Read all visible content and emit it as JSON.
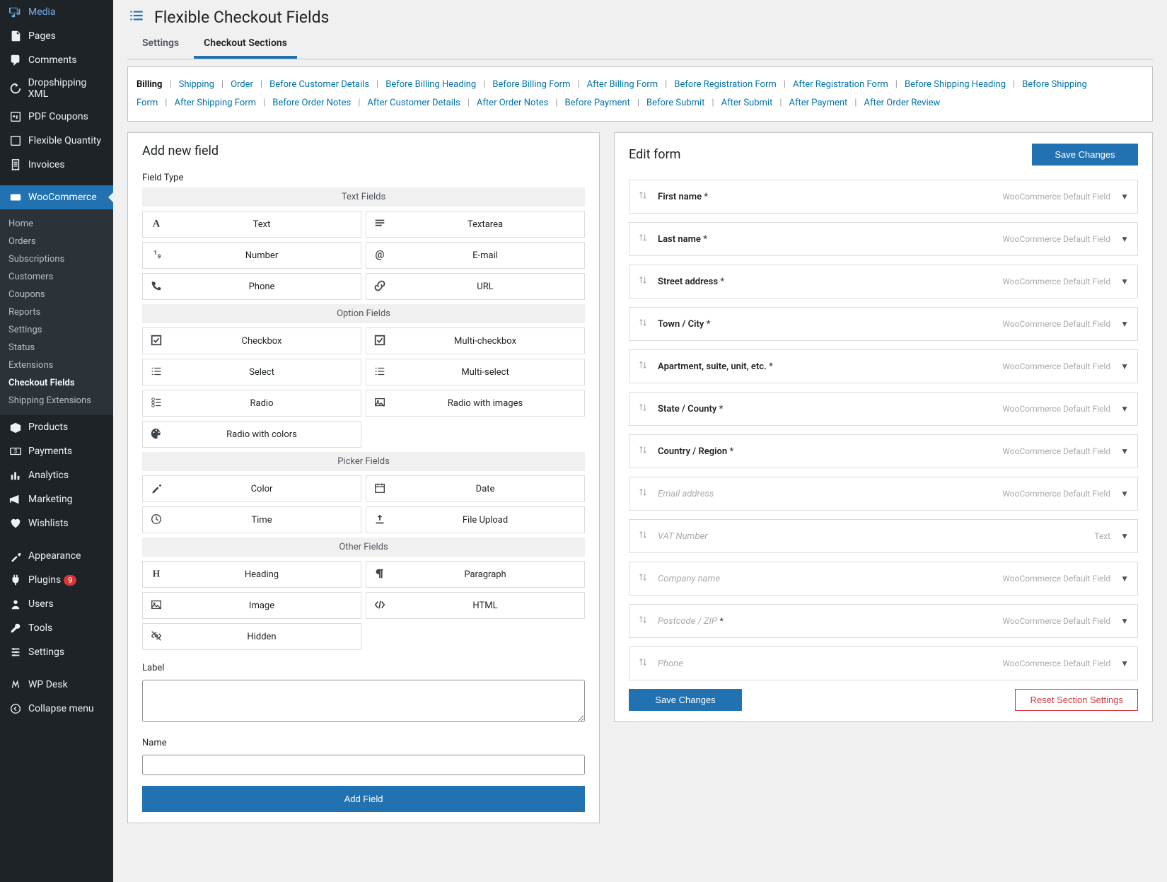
{
  "page_title": "Flexible Checkout Fields",
  "sidebar": {
    "items": [
      {
        "label": "Media",
        "icon": "media"
      },
      {
        "label": "Pages",
        "icon": "page"
      },
      {
        "label": "Comments",
        "icon": "comment"
      },
      {
        "label": "Dropshipping XML",
        "icon": "loop"
      },
      {
        "label": "PDF Coupons",
        "icon": "pdf"
      },
      {
        "label": "Flexible Quantity",
        "icon": "flex"
      },
      {
        "label": "Invoices",
        "icon": "invoice"
      },
      {
        "label": "WooCommerce",
        "icon": "woo",
        "current": true
      },
      {
        "label": "Products",
        "icon": "products"
      },
      {
        "label": "Payments",
        "icon": "payments"
      },
      {
        "label": "Analytics",
        "icon": "analytics"
      },
      {
        "label": "Marketing",
        "icon": "marketing"
      },
      {
        "label": "Wishlists",
        "icon": "heart"
      },
      {
        "label": "Appearance",
        "icon": "appearance"
      },
      {
        "label": "Plugins",
        "icon": "plugins",
        "badge": "9"
      },
      {
        "label": "Users",
        "icon": "users"
      },
      {
        "label": "Tools",
        "icon": "tools"
      },
      {
        "label": "Settings",
        "icon": "settings"
      },
      {
        "label": "WP Desk",
        "icon": "wpdesk"
      },
      {
        "label": "Collapse menu",
        "icon": "collapse"
      }
    ],
    "submenu": [
      "Home",
      "Orders",
      "Subscriptions",
      "Customers",
      "Coupons",
      "Reports",
      "Settings",
      "Status",
      "Extensions",
      "Checkout Fields",
      "Shipping Extensions"
    ],
    "submenu_current": "Checkout Fields"
  },
  "tabs": [
    "Settings",
    "Checkout Sections"
  ],
  "tabs_active": "Checkout Sections",
  "sections": [
    "Billing",
    "Shipping",
    "Order",
    "Before Customer Details",
    "Before Billing Heading",
    "Before Billing Form",
    "After Billing Form",
    "Before Registration Form",
    "After Registration Form",
    "Before Shipping Heading",
    "Before Shipping Form",
    "After Shipping Form",
    "Before Order Notes",
    "After Customer Details",
    "After Order Notes",
    "Before Payment",
    "Before Submit",
    "After Submit",
    "After Payment",
    "After Order Review"
  ],
  "sections_active": "Billing",
  "left_panel": {
    "title": "Add new field",
    "field_type_label": "Field Type",
    "groups": [
      {
        "title": "Text Fields",
        "items": [
          {
            "label": "Text",
            "icon": "text"
          },
          {
            "label": "Textarea",
            "icon": "textarea"
          },
          {
            "label": "Number",
            "icon": "number"
          },
          {
            "label": "E-mail",
            "icon": "email"
          },
          {
            "label": "Phone",
            "icon": "phone"
          },
          {
            "label": "URL",
            "icon": "url"
          }
        ]
      },
      {
        "title": "Option Fields",
        "items": [
          {
            "label": "Checkbox",
            "icon": "checkbox"
          },
          {
            "label": "Multi-checkbox",
            "icon": "multicheckbox"
          },
          {
            "label": "Select",
            "icon": "select"
          },
          {
            "label": "Multi-select",
            "icon": "multiselect"
          },
          {
            "label": "Radio",
            "icon": "radio"
          },
          {
            "label": "Radio with images",
            "icon": "radioimg"
          },
          {
            "label": "Radio with colors",
            "icon": "radiocolor"
          }
        ]
      },
      {
        "title": "Picker Fields",
        "items": [
          {
            "label": "Color",
            "icon": "color"
          },
          {
            "label": "Date",
            "icon": "date"
          },
          {
            "label": "Time",
            "icon": "time"
          },
          {
            "label": "File Upload",
            "icon": "upload"
          }
        ]
      },
      {
        "title": "Other Fields",
        "items": [
          {
            "label": "Heading",
            "icon": "heading"
          },
          {
            "label": "Paragraph",
            "icon": "paragraph"
          },
          {
            "label": "Image",
            "icon": "image"
          },
          {
            "label": "HTML",
            "icon": "html"
          },
          {
            "label": "Hidden",
            "icon": "hidden"
          }
        ]
      }
    ],
    "label_label": "Label",
    "name_label": "Name",
    "add_button": "Add Field"
  },
  "right_panel": {
    "title": "Edit form",
    "save_button": "Save Changes",
    "reset_button": "Reset Section Settings",
    "default_type": "WooCommerce Default Field",
    "fields": [
      {
        "name": "First name",
        "required": true,
        "type": "WooCommerce Default Field",
        "bold": true
      },
      {
        "name": "Last name",
        "required": true,
        "type": "WooCommerce Default Field",
        "bold": true
      },
      {
        "name": "Street address",
        "required": true,
        "type": "WooCommerce Default Field",
        "bold": true
      },
      {
        "name": "Town / City",
        "required": true,
        "type": "WooCommerce Default Field",
        "bold": true
      },
      {
        "name": "Apartment, suite, unit, etc.",
        "required": true,
        "type": "WooCommerce Default Field",
        "bold": true
      },
      {
        "name": "State / County",
        "required": true,
        "type": "WooCommerce Default Field",
        "bold": true
      },
      {
        "name": "Country / Region",
        "required": true,
        "type": "WooCommerce Default Field",
        "bold": true
      },
      {
        "name": "Email address",
        "required": false,
        "type": "WooCommerce Default Field",
        "disabled": true
      },
      {
        "name": "VAT Number",
        "required": false,
        "type": "Text",
        "disabled": true
      },
      {
        "name": "Company name",
        "required": false,
        "type": "WooCommerce Default Field",
        "disabled": true
      },
      {
        "name": "Postcode / ZIP",
        "required": true,
        "type": "WooCommerce Default Field",
        "disabled": true
      },
      {
        "name": "Phone",
        "required": false,
        "type": "WooCommerce Default Field",
        "disabled": true
      }
    ]
  }
}
